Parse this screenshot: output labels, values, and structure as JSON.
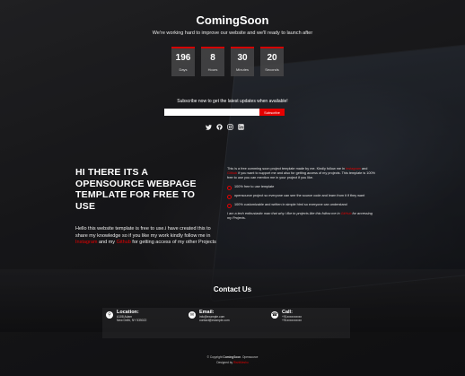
{
  "header": {
    "title": "ComingSoon",
    "subtitle": "We're working hard to improve our website and we'll ready to launch after"
  },
  "countdown": [
    {
      "value": "196",
      "label": "Days"
    },
    {
      "value": "8",
      "label": "Hours"
    },
    {
      "value": "30",
      "label": "Minutes"
    },
    {
      "value": "20",
      "label": "Seconds"
    }
  ],
  "subscribe": {
    "text": "Subscribe now to get the latest updates when available!",
    "placeholder": "",
    "button_label": "Subscribe"
  },
  "social": [
    "twitter-icon",
    "github-icon",
    "instagram-icon",
    "linkedin-icon"
  ],
  "about": {
    "heading": "HI THERE ITS A OPENSOURCE WEBPAGE TEMPLATE FOR FREE TO USE",
    "para_1": "Hello this website template is free to use.i have created this to share my knowledge so if you like my work kindly follow me in ",
    "instagram": "Instagram",
    "para_2": " and my ",
    "github": "Github",
    "para_3": " for getting access of my other Projects"
  },
  "details": {
    "intro_1": "This is a free comming soon project template made by me. Kindly follow me in ",
    "intro_instagram": "Instagram",
    "intro_2": " and ",
    "intro_github": "Github",
    "intro_3": " if you want to support me and also for getting access of my projects. This template is 100% free to use you can mention me in your project if you like.",
    "features": [
      "100% free to use template",
      "opensource project so everyone can see the source code and learn from it if they want",
      "100% customizable and written in simple html so everyone can understand"
    ],
    "outro_1": "I am a tech enthusiastic man that why i like to projects like this follow me in ",
    "outro_link": "GitHub",
    "outro_2": " for accessing my Projects."
  },
  "contact": {
    "title": "Contact Us",
    "cards": [
      {
        "icon": "location-icon",
        "title": "Location:",
        "lines": [
          "A108 Adam",
          "New Delhi, NY 535022"
        ]
      },
      {
        "icon": "mail-icon",
        "title": "Email:",
        "lines": [
          "info@example.com",
          "contact@example.com"
        ]
      },
      {
        "icon": "phone-icon",
        "title": "Call:",
        "lines": [
          "+91xxxxxxxxxx",
          "+91xxxxxxxxxx"
        ]
      }
    ]
  },
  "footer": {
    "copyright_prefix": "© Copyright ",
    "brand": "ComingSoon",
    "copyright_suffix": ". Opensource",
    "designed_prefix": "Designed by ",
    "designer": "RishiMeshu"
  },
  "colors": {
    "accent": "#e50000",
    "box": "#464648"
  }
}
